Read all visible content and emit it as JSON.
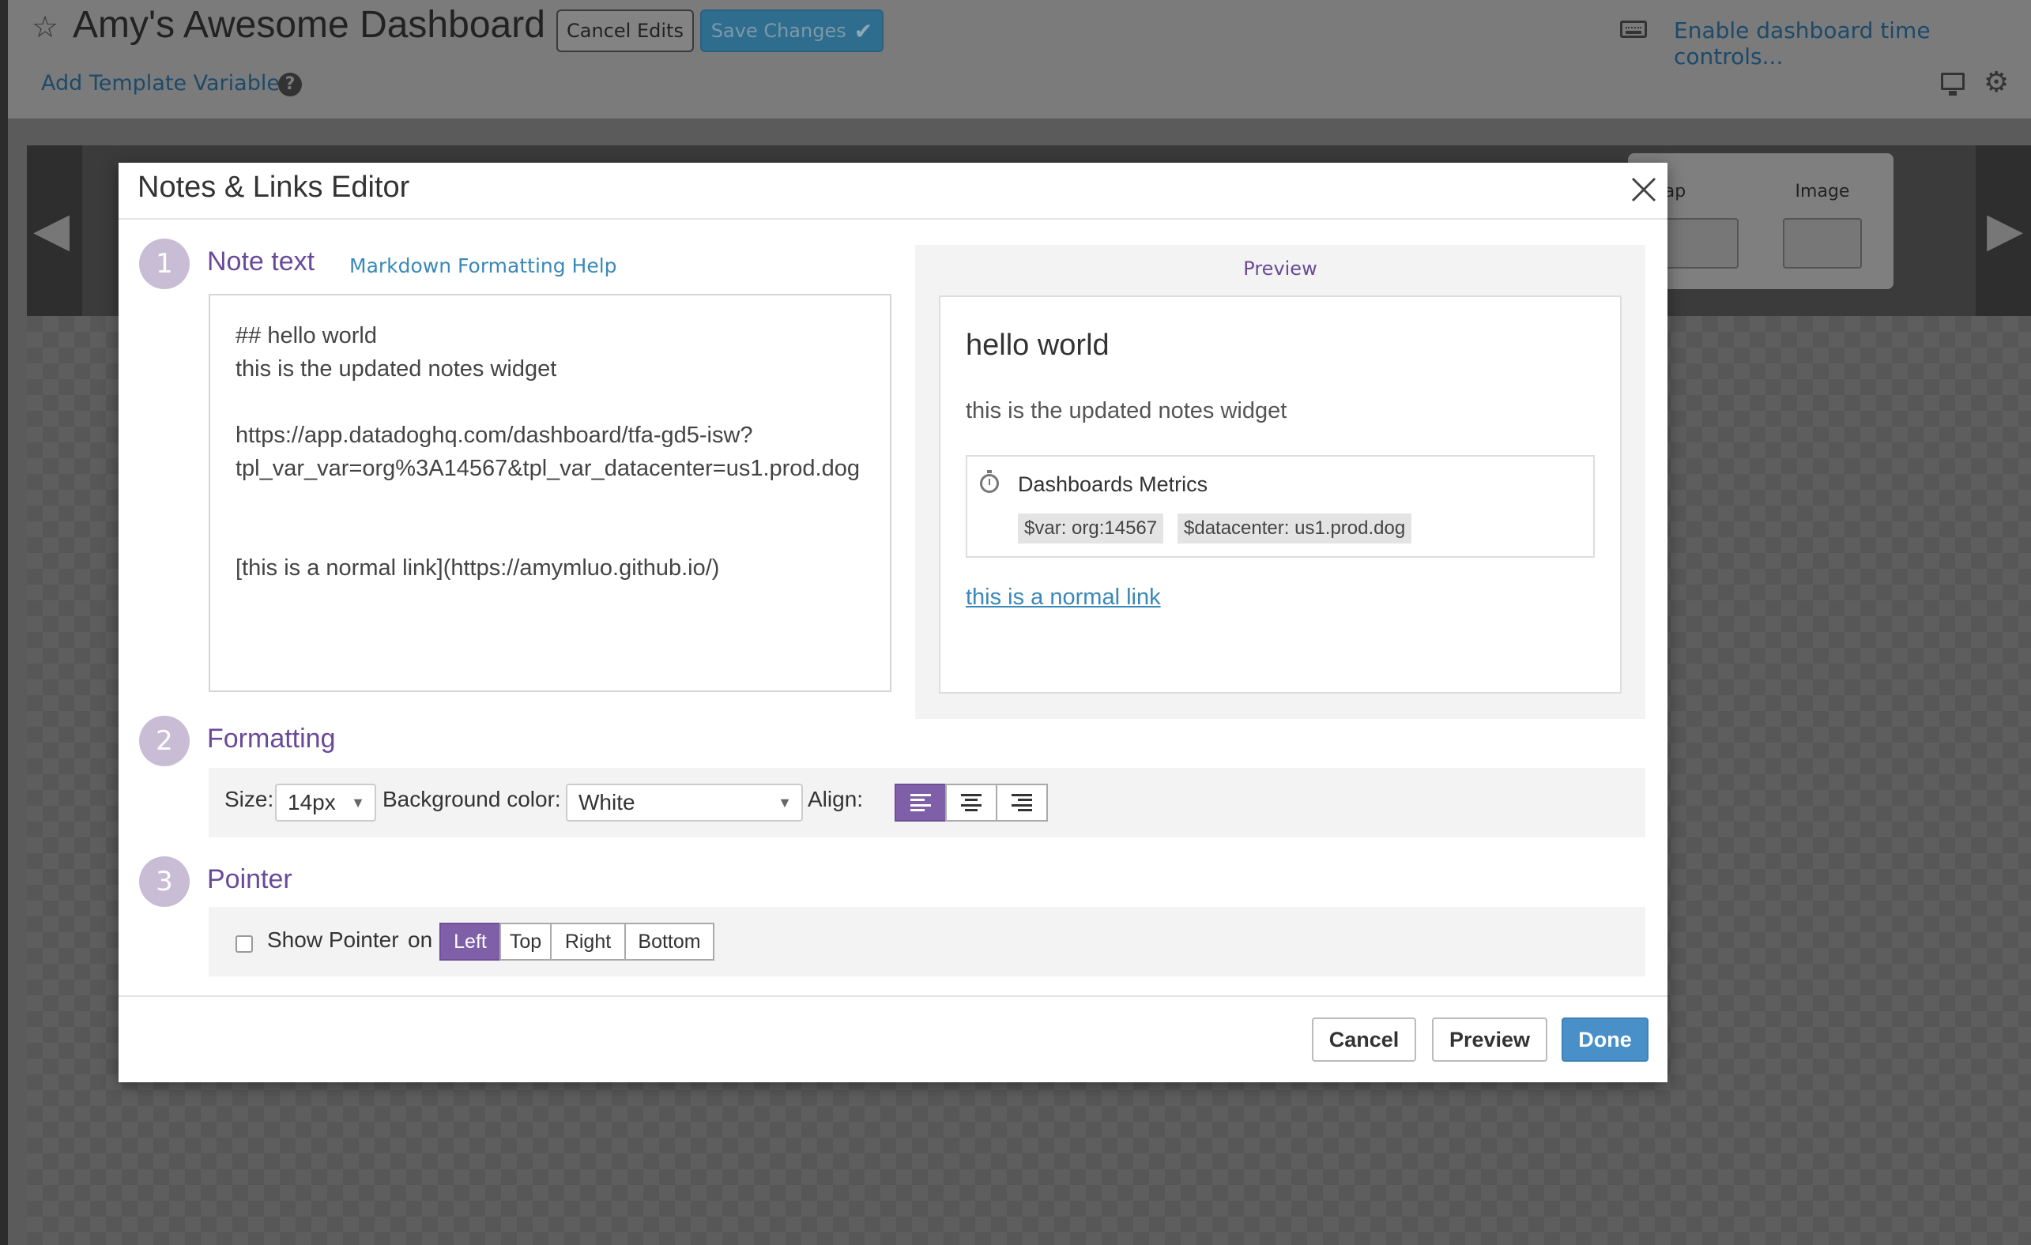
{
  "dashboard": {
    "title": "Amy's Awesome Dashboard",
    "cancel_edits": "Cancel Edits",
    "save_changes": "Save Changes",
    "time_controls": "Enable dashboard time controls...",
    "add_template_variables": "Add Template Variables",
    "tray_visible_labels": [
      "Map",
      "Image"
    ]
  },
  "modal": {
    "title": "Notes & Links Editor",
    "step1": {
      "number": "1",
      "title": "Note text",
      "help_link": "Markdown Formatting Help"
    },
    "note_text": "## hello world\nthis is the updated notes widget\n\nhttps://app.datadoghq.com/dashboard/tfa-gd5-isw?\ntpl_var_var=org%3A14567&tpl_var_datacenter=us1.prod.dog\n\n\n[this is a normal link](https://amymluo.github.io/)",
    "preview": {
      "label": "Preview",
      "heading": "hello world",
      "body": "this is the updated notes widget",
      "card_title": "Dashboards Metrics",
      "tags": [
        "$var: org:14567",
        "$datacenter: us1.prod.dog"
      ],
      "link": "this is a normal link"
    },
    "step2": {
      "number": "2",
      "title": "Formatting",
      "size_label": "Size:",
      "size_value": "14px",
      "bg_label": "Background color:",
      "bg_value": "White",
      "align_label": "Align:",
      "align_selected": "left"
    },
    "step3": {
      "number": "3",
      "title": "Pointer",
      "show_pointer_label": "Show Pointer",
      "show_pointer_checked": false,
      "on_label": "on",
      "options": [
        "Left",
        "Top",
        "Right",
        "Bottom"
      ],
      "selected": "Left"
    },
    "footer": {
      "cancel": "Cancel",
      "preview": "Preview",
      "done": "Done"
    }
  },
  "colors": {
    "accent_purple": "#7f5fa8",
    "link_blue": "#3a88b8",
    "done_blue": "#4a90c8"
  },
  "icons": [
    "star-icon",
    "check-icon",
    "keyboard-icon",
    "help-icon",
    "monitor-icon",
    "gear-icon",
    "close-icon",
    "stopwatch-icon",
    "align-left-icon",
    "align-center-icon",
    "align-right-icon"
  ]
}
